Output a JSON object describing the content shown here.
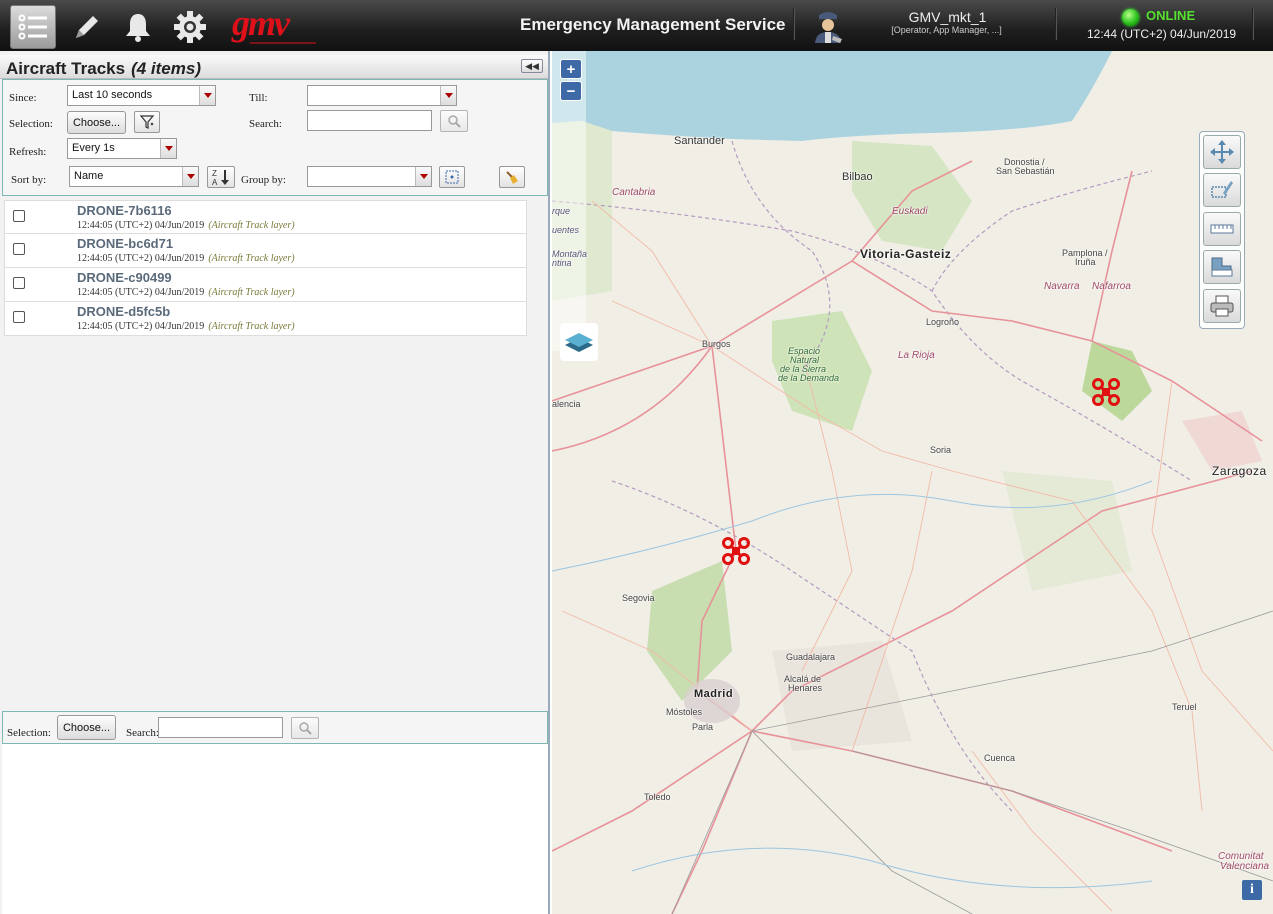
{
  "header": {
    "app_title": "Emergency Management Service",
    "user_name": "GMV_mkt_1",
    "user_roles": "[Operator, App Manager, ...]",
    "status": "ONLINE",
    "status_time": "12:44 (UTC+2) 04/Jun/2019",
    "status_color": "#2cc21c",
    "icons": [
      "list-icon",
      "pencil-icon",
      "bell-icon",
      "gear-icon"
    ]
  },
  "panel": {
    "title": "Aircraft Tracks",
    "count": "(4 items)",
    "filters": {
      "since_label": "Since:",
      "since_value": "Last 10 seconds",
      "till_label": "Till:",
      "till_value": "",
      "selection_label": "Selection:",
      "choose_label": "Choose...",
      "search_label": "Search:",
      "search_value": "",
      "refresh_label": "Refresh:",
      "refresh_value": "Every 1s",
      "sortby_label": "Sort by:",
      "sortby_value": "Name",
      "groupby_label": "Group by:",
      "groupby_value": ""
    },
    "tracks": [
      {
        "name": "DRONE-7b6116",
        "time": "12:44:05 (UTC+2) 04/Jun/2019",
        "layer": "(Aircraft Track layer)"
      },
      {
        "name": "DRONE-bc6d71",
        "time": "12:44:05 (UTC+2) 04/Jun/2019",
        "layer": "(Aircraft Track layer)"
      },
      {
        "name": "DRONE-c90499",
        "time": "12:44:05 (UTC+2) 04/Jun/2019",
        "layer": "(Aircraft Track layer)"
      },
      {
        "name": "DRONE-d5fc5b",
        "time": "12:44:05 (UTC+2) 04/Jun/2019",
        "layer": "(Aircraft Track layer)"
      }
    ],
    "bottom": {
      "selection_label": "Selection:",
      "choose_label": "Choose...",
      "search_label": "Search:",
      "search_value": ""
    }
  },
  "map": {
    "zoom_in": "+",
    "zoom_out": "−",
    "info": "i",
    "labels": {
      "santander": "Santander",
      "bilbao": "Bilbao",
      "donostia": "Donostia /",
      "san_sebastian": "San Sebastián",
      "cantabria": "Cantabria",
      "euskadi": "Euskadi",
      "vitoria": "Vitoria-Gasteiz",
      "pamplona": "Pamplona /",
      "iruna": "Iruña",
      "navarra": "Navarra",
      "nafarroa": "Nafarroa",
      "logrono": "Logroño",
      "burgos": "Burgos",
      "la_rioja": "La Rioja",
      "park_1": "Espacio",
      "park_2": "Natural",
      "park_3": "de la Sierra",
      "park_4": "de la Demanda",
      "palencia": "alencia",
      "soria": "Soria",
      "zaragoza": "Zaragoza",
      "segovia": "Segovia",
      "guadalajara": "Guadalajara",
      "alcala_1": "Alcalá de",
      "alcala_2": "Henares",
      "madrid": "Madrid",
      "mostoles": "Móstoles",
      "parla": "Parla",
      "toledo": "Toledo",
      "cuenca": "Cuenca",
      "teruel": "Teruel",
      "valenciana_1": "Comunitat",
      "valenciana_2": "Valenciana",
      "montana_1": "rque",
      "montana_2": "uentes",
      "montana_3": "Montaña",
      "montana_4": "ntina"
    },
    "drones_visible": 2
  }
}
